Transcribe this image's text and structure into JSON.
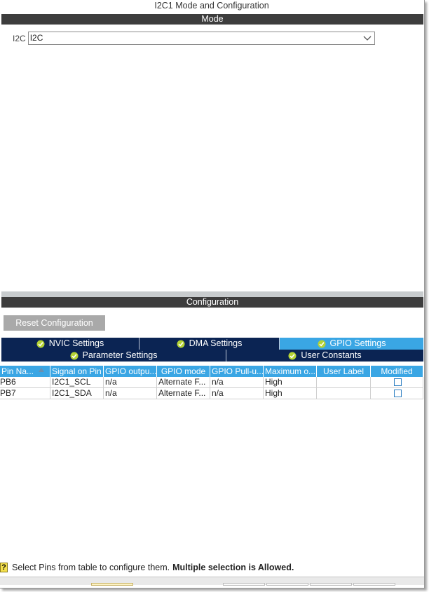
{
  "window": {
    "title": "I2C1 Mode and Configuration"
  },
  "mode": {
    "header": "Mode",
    "field_label": "I2C",
    "field_value": "I2C"
  },
  "configuration": {
    "header": "Configuration",
    "reset_label": "Reset Configuration",
    "tabs_row1": [
      {
        "label": "NVIC Settings",
        "active": false
      },
      {
        "label": "DMA Settings",
        "active": false
      },
      {
        "label": "GPIO Settings",
        "active": true
      }
    ],
    "tabs_row2": [
      {
        "label": "Parameter Settings",
        "active": false
      },
      {
        "label": "User Constants",
        "active": false
      }
    ],
    "table": {
      "columns": [
        "Pin Na...",
        "Signal on Pin",
        "GPIO outpu...",
        "GPIO mode",
        "GPIO Pull-u...",
        "Maximum o...",
        "User Label",
        "Modified"
      ],
      "rows": [
        [
          "PB6",
          "I2C1_SCL",
          "n/a",
          "Alternate F...",
          "n/a",
          "High",
          "",
          ""
        ],
        [
          "PB7",
          "I2C1_SDA",
          "n/a",
          "Alternate F...",
          "n/a",
          "High",
          "",
          ""
        ]
      ]
    },
    "hint_prefix": "Select Pins from table to configure them.",
    "hint_bold": "Multiple selection is Allowed."
  },
  "colors": {
    "section_bar": "#3d3d3d",
    "tab_dark": "#0b2453",
    "tab_active": "#3aa6e4",
    "check_green": "#b5d334"
  }
}
